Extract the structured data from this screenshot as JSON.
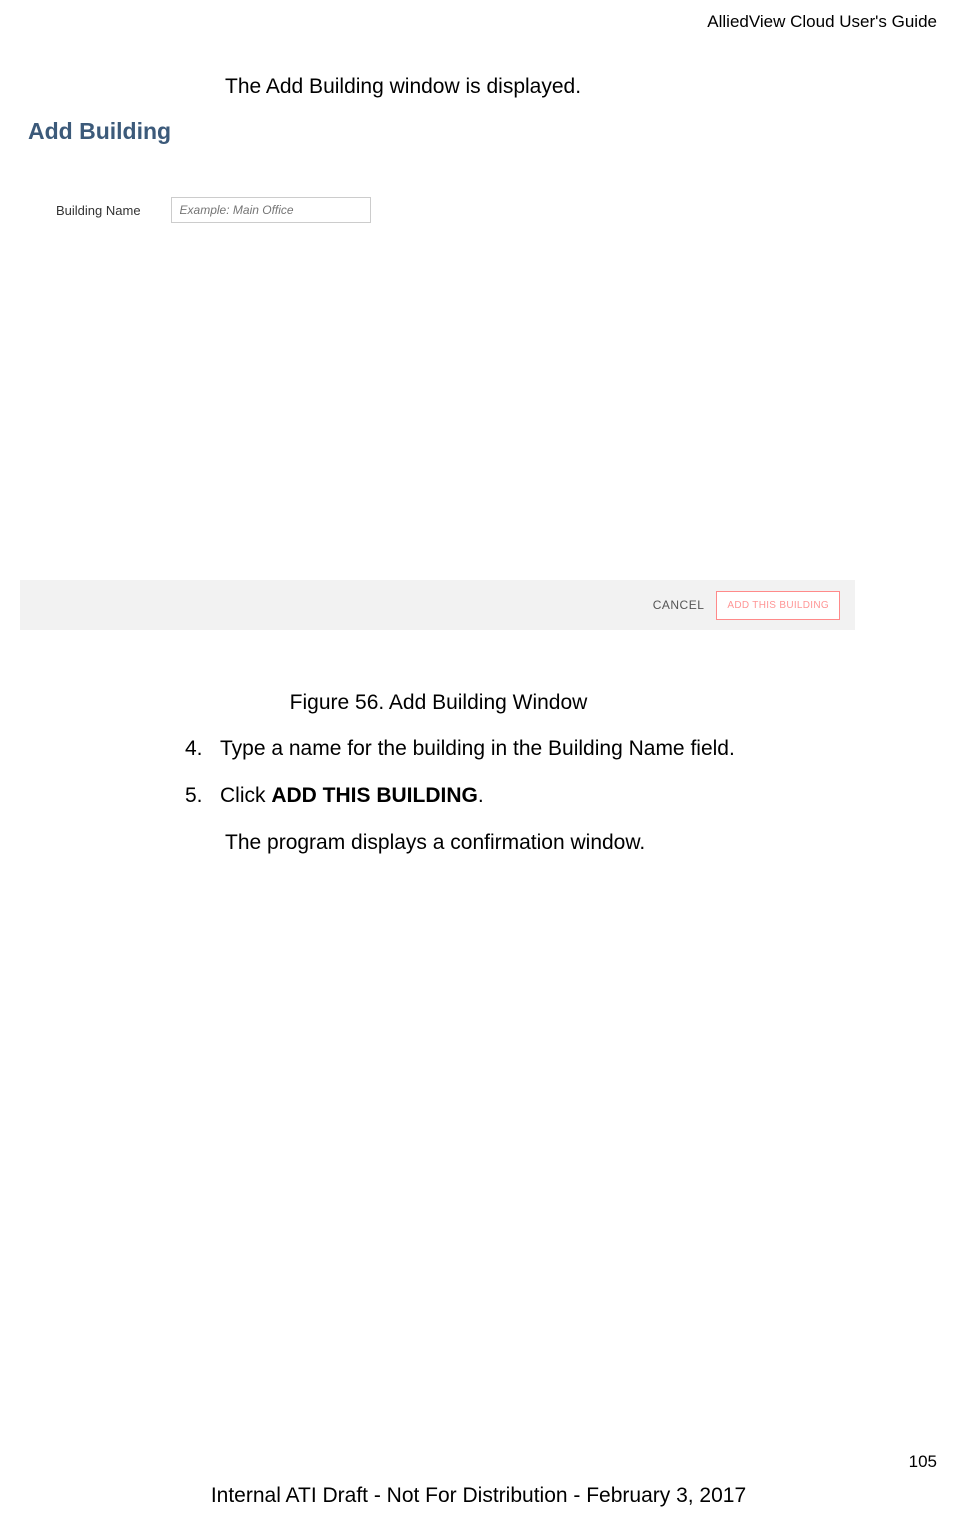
{
  "header": {
    "guide_title": "AlliedView Cloud User's Guide"
  },
  "intro": "The Add Building window is displayed.",
  "screenshot": {
    "title": "Add Building",
    "field_label": "Building Name",
    "field_placeholder": "Example: Main Office",
    "cancel_label": "CANCEL",
    "add_label": "ADD THIS BUILDING"
  },
  "figure_caption": "Figure 56. Add Building Window",
  "steps": {
    "s4_num": "4.",
    "s4_text": "Type a name for the building in the Building Name field.",
    "s5_num": "5.",
    "s5_prefix": "Click ",
    "s5_bold": "ADD THIS BUILDING",
    "s5_suffix": "."
  },
  "confirmation": "The program displays a confirmation window.",
  "page_number": "105",
  "footer": "Internal ATI Draft - Not For Distribution - February 3, 2017"
}
